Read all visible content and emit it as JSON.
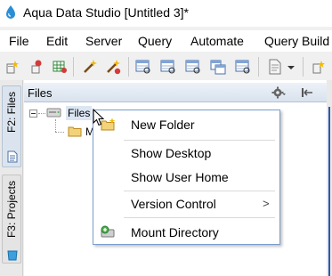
{
  "window": {
    "title": "Aqua Data Studio [Untitled 3]*"
  },
  "menubar": {
    "items": [
      "File",
      "Edit",
      "Server",
      "Query",
      "Automate",
      "Query Build"
    ]
  },
  "toolbar": {
    "icons": [
      "new-sql-icon",
      "pin-icon",
      "grid-icon",
      "wand-icon",
      "wand-stop-icon",
      "table-icon",
      "table-edit-icon",
      "table-view-icon",
      "table-compare-icon",
      "table-export-icon",
      "document-icon",
      "dropdown-icon"
    ]
  },
  "sidetabs": [
    {
      "label": "F2: Files",
      "icon": "file-icon"
    },
    {
      "label": "F3: Projects",
      "icon": "bucket-icon"
    }
  ],
  "panel": {
    "title": "Files"
  },
  "tree": {
    "root_label": "Files",
    "child_label": "M"
  },
  "context_menu": {
    "items": [
      {
        "label": "New Folder",
        "icon": "new-folder-icon"
      },
      {
        "label": "Show Desktop"
      },
      {
        "label": "Show User Home"
      },
      {
        "label": "Version Control",
        "submenu": ">"
      },
      {
        "label": "Mount Directory",
        "icon": "mount-directory-icon"
      }
    ]
  }
}
